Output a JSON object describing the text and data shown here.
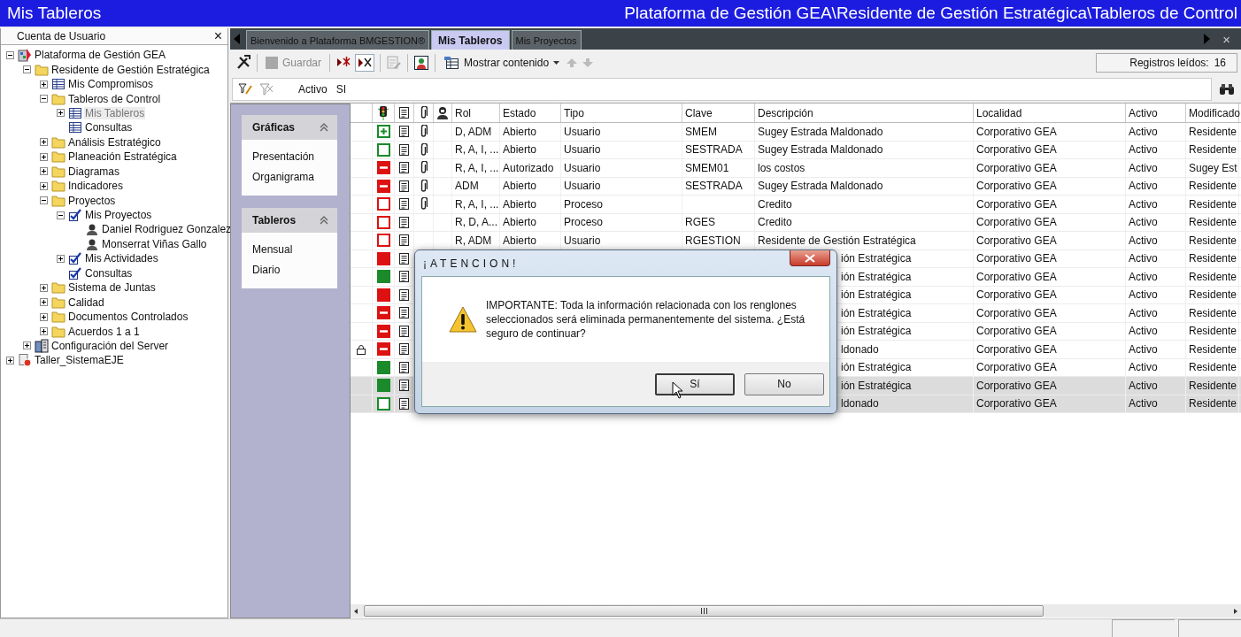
{
  "window": {
    "title": "Mis Tableros",
    "path": "Plataforma de Gestión GEA\\Residente de Gestión Estratégica\\Tableros de Control"
  },
  "sidebar": {
    "title": "Cuenta de Usuario",
    "close": "×",
    "tree": [
      {
        "label": "Plataforma de Gestión GEA",
        "kind": "app",
        "expanded": true,
        "selected": false,
        "children": [
          {
            "label": "Residente de Gestión Estratégica",
            "kind": "folder",
            "expanded": true,
            "selected": false,
            "children": [
              {
                "label": "Mis Compromisos",
                "kind": "table",
                "expanded": false,
                "selected": false
              },
              {
                "label": "Tableros de Control",
                "kind": "folder",
                "expanded": true,
                "selected": false,
                "children": [
                  {
                    "label": "Mis Tableros",
                    "kind": "table",
                    "expanded": false,
                    "selected": true
                  },
                  {
                    "label": "Consultas",
                    "kind": "table",
                    "selected": false
                  }
                ]
              },
              {
                "label": "Análisis Estratégico",
                "kind": "folder",
                "expanded": false,
                "selected": false
              },
              {
                "label": "Planeación Estratégica",
                "kind": "folder",
                "expanded": false,
                "selected": false
              },
              {
                "label": "Diagramas",
                "kind": "folder",
                "expanded": false,
                "selected": false
              },
              {
                "label": "Indicadores",
                "kind": "folder",
                "expanded": false,
                "selected": false
              },
              {
                "label": "Proyectos",
                "kind": "folder",
                "expanded": true,
                "selected": false,
                "children": [
                  {
                    "label": "Mis Proyectos",
                    "kind": "check",
                    "expanded": true,
                    "selected": false,
                    "children": [
                      {
                        "label": "Daniel Rodriguez Gonzalez",
                        "kind": "person",
                        "selected": false
                      },
                      {
                        "label": "Monserrat Viñas Gallo",
                        "kind": "person",
                        "selected": false
                      }
                    ]
                  },
                  {
                    "label": "Mis Actividades",
                    "kind": "check",
                    "expanded": false,
                    "selected": false
                  },
                  {
                    "label": "Consultas",
                    "kind": "check",
                    "selected": false
                  }
                ]
              },
              {
                "label": "Sistema de Juntas",
                "kind": "folder",
                "expanded": false,
                "selected": false
              },
              {
                "label": "Calidad",
                "kind": "folder",
                "expanded": false,
                "selected": false
              },
              {
                "label": "Documentos Controlados",
                "kind": "folder",
                "expanded": false,
                "selected": false
              },
              {
                "label": "Acuerdos 1 a 1",
                "kind": "folder",
                "expanded": false,
                "selected": false
              }
            ]
          },
          {
            "label": "Configuración del Server",
            "kind": "server",
            "expanded": false,
            "selected": false
          }
        ]
      },
      {
        "label": "Taller_SistemaEJE",
        "kind": "taller",
        "expanded": false,
        "selected": false
      }
    ]
  },
  "tabs": [
    {
      "label": "Bienvenido a Plataforma BMGESTION®",
      "selected": false
    },
    {
      "label": "Mis Tableros",
      "selected": true
    },
    {
      "label": "Mis Proyectos",
      "selected": false
    }
  ],
  "tab_close": "×",
  "toolbar": {
    "save": {
      "label": "Guardar",
      "disabled": true
    },
    "show_content": "Mostrar contenido",
    "records_label": "Registros leídos:",
    "records_count": "16"
  },
  "filter": {
    "field": "Activo",
    "value": "SI"
  },
  "panels": [
    {
      "title": "Gráficas",
      "items": [
        "Presentación",
        "Organigrama"
      ]
    },
    {
      "title": "Tableros",
      "items": [
        "Mensual",
        "Diario"
      ]
    }
  ],
  "table": {
    "columns": [
      "Rol",
      "Estado",
      "Tipo",
      "Clave",
      "Descripción",
      "Localidad",
      "Activo",
      "Modificado"
    ],
    "rows": [
      {
        "locked": false,
        "kind": "plus",
        "color": "#1a8a2a",
        "attachment": true,
        "selected": false,
        "cells": [
          "D, ADM",
          "Abierto",
          "Usuario",
          "SMEM",
          "Sugey Estrada Maldonado",
          "Corporativo GEA",
          "Activo",
          "Residente"
        ]
      },
      {
        "locked": false,
        "kind": "empty",
        "color": "#1a8a2a",
        "attachment": true,
        "selected": false,
        "cells": [
          "R, A, I, ...",
          "Abierto",
          "Usuario",
          "SESTRADA",
          "Sugey Estrada Maldonado",
          "Corporativo GEA",
          "Activo",
          "Residente"
        ]
      },
      {
        "locked": false,
        "kind": "minus",
        "color": "#dd1111",
        "attachment": true,
        "selected": false,
        "cells": [
          "R, A, I, ...",
          "Autorizado",
          "Usuario",
          "SMEM01",
          "los costos",
          "Corporativo GEA",
          "Activo",
          "Sugey Est"
        ]
      },
      {
        "locked": false,
        "kind": "minus",
        "color": "#dd1111",
        "attachment": true,
        "selected": false,
        "cells": [
          "ADM",
          "Abierto",
          "Usuario",
          "SESTRADA",
          "Sugey Estrada Maldonado",
          "Corporativo GEA",
          "Activo",
          "Residente"
        ]
      },
      {
        "locked": false,
        "kind": "empty",
        "color": "#dd1111",
        "attachment": true,
        "selected": false,
        "cells": [
          "R, A, I, ...",
          "Abierto",
          "Proceso",
          "",
          "Credito",
          "Corporativo GEA",
          "Activo",
          "Residente"
        ]
      },
      {
        "locked": false,
        "kind": "empty",
        "color": "#dd1111",
        "attachment": false,
        "selected": false,
        "cells": [
          "R, D, A...",
          "Abierto",
          "Proceso",
          "RGES",
          "Credito",
          "Corporativo GEA",
          "Activo",
          "Residente"
        ]
      },
      {
        "locked": false,
        "kind": "empty",
        "color": "#dd1111",
        "attachment": false,
        "selected": false,
        "cells": [
          "R, ADM",
          "Abierto",
          "Usuario",
          "RGESTION",
          "Residente de Gestión Estratégica",
          "Corporativo GEA",
          "Activo",
          "Residente"
        ]
      },
      {
        "locked": false,
        "kind": "solid",
        "color": "#dd1111",
        "attachment": false,
        "selected": false,
        "tail": [
          "ión Estratégica",
          "Corporativo GEA",
          "Activo",
          "Residente"
        ]
      },
      {
        "locked": false,
        "kind": "solid",
        "color": "#1a8a2a",
        "attachment": false,
        "selected": false,
        "tail": [
          "ión Estratégica",
          "Corporativo GEA",
          "Activo",
          "Residente"
        ]
      },
      {
        "locked": false,
        "kind": "solid",
        "color": "#dd1111",
        "attachment": false,
        "selected": false,
        "tail": [
          "ión Estratégica",
          "Corporativo GEA",
          "Activo",
          "Residente"
        ]
      },
      {
        "locked": false,
        "kind": "minus",
        "color": "#dd1111",
        "attachment": false,
        "selected": false,
        "tail": [
          "ión Estratégica",
          "Corporativo GEA",
          "Activo",
          "Residente"
        ]
      },
      {
        "locked": false,
        "kind": "minus",
        "color": "#dd1111",
        "attachment": false,
        "selected": false,
        "tail": [
          "ión Estratégica",
          "Corporativo GEA",
          "Activo",
          "Residente"
        ]
      },
      {
        "locked": true,
        "kind": "minus",
        "color": "#dd1111",
        "attachment": false,
        "selected": false,
        "tail": [
          "ldonado",
          "Corporativo GEA",
          "Activo",
          "Residente"
        ]
      },
      {
        "locked": false,
        "kind": "solid",
        "color": "#1a8a2a",
        "attachment": false,
        "selected": false,
        "tail": [
          "ión Estratégica",
          "Corporativo GEA",
          "Activo",
          "Residente"
        ]
      },
      {
        "locked": false,
        "kind": "solid",
        "color": "#1a8a2a",
        "attachment": false,
        "selected": true,
        "tail": [
          "ión Estratégica",
          "Corporativo GEA",
          "Activo",
          "Residente"
        ]
      },
      {
        "locked": false,
        "kind": "empty",
        "color": "#1a8a2a",
        "attachment": false,
        "selected": true,
        "tail": [
          "ldonado",
          "Corporativo GEA",
          "Activo",
          "Residente"
        ]
      }
    ]
  },
  "dialog": {
    "title": "¡ATENCION!",
    "message": "IMPORTANTE: Toda la información relacionada con los renglones seleccionados será eliminada permanentemente del sistema. ¿Está seguro de continuar?",
    "buttons": [
      {
        "label": "Sí",
        "focused": true
      },
      {
        "label": "No",
        "focused": false
      }
    ]
  }
}
